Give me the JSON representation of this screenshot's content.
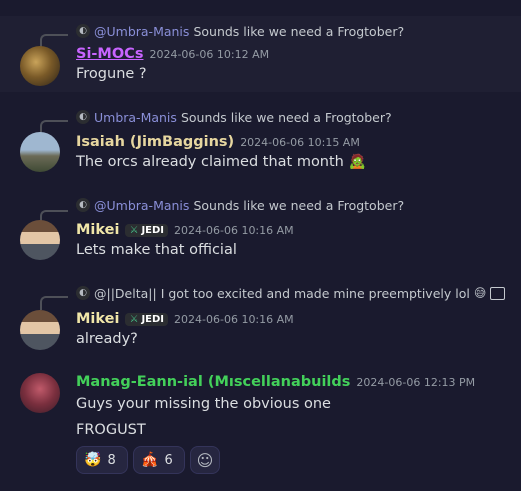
{
  "messages": [
    {
      "reply": {
        "author": "@Umbra-Manis",
        "text": "Sounds like we need a Frogtober?"
      },
      "author": "Si-MOCs",
      "author_color": "#c864ff",
      "timestamp": "2024-06-06 10:12 AM",
      "text": "Frogune ?"
    },
    {
      "reply": {
        "author": "Umbra-Manis",
        "text": "Sounds like we need a Frogtober?"
      },
      "author": "Isaiah (JimBaggins)",
      "author_color": "#e7d7a0",
      "timestamp": "2024-06-06 10:15 AM",
      "text": "The orcs already claimed that month",
      "text_emoji": "🧟"
    },
    {
      "reply": {
        "author": "@Umbra-Manis",
        "text": "Sounds like we need a Frogtober?"
      },
      "author": "Mikei",
      "author_color": "#f0e6a8",
      "badge": "JEDI",
      "timestamp": "2024-06-06 10:16 AM",
      "text": "Lets make that official"
    },
    {
      "reply": {
        "author": "@||Delta||",
        "text": "I got too excited and made mine preemptively lol",
        "emoji": "😅"
      },
      "author": "Mikei",
      "author_color": "#f0e6a8",
      "badge": "JEDI",
      "timestamp": "2024-06-06 10:16 AM",
      "text": "already?"
    },
    {
      "author": "Manag-Eann-ial (Mıscellanabuilds",
      "author_color": "#43d05a",
      "timestamp": "2024-06-06 12:13 PM",
      "text": "Guys your missing the obvious one",
      "text2": "FROGUST",
      "reactions": [
        {
          "emoji": "🤯",
          "count": "8"
        },
        {
          "emoji": "🎪",
          "count": "6"
        }
      ],
      "add_reaction_icon": "☺"
    }
  ],
  "icons": {
    "reply_avatar": "avatar-mini-icon",
    "image_attachment": "image-icon",
    "badge_icon": "sword-icon"
  }
}
